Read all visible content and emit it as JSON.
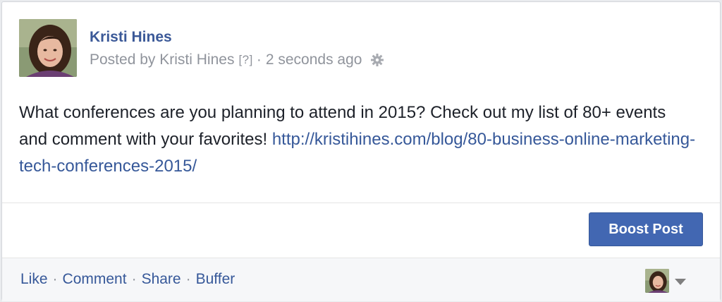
{
  "post": {
    "author_name": "Kristi Hines",
    "meta": {
      "prefix": "Posted by",
      "poster": "Kristi Hines",
      "help": "[?]",
      "separator": "·",
      "time": "2 seconds ago"
    },
    "text": "What conferences are you planning to attend in 2015? Check out my list of 80+ events and comment with your favorites! ",
    "link": "http://kristihines.com/blog/80-business-online-marketing-tech-conferences-2015/"
  },
  "boost_button": {
    "label": "Boost Post"
  },
  "footer": {
    "actions": [
      "Like",
      "Comment",
      "Share",
      "Buffer"
    ],
    "separator": "·"
  },
  "colors": {
    "link_blue": "#365899",
    "author_blue": "#3b5998",
    "boost_bg": "#4267b2",
    "meta_gray": "#90949c"
  },
  "icons": [
    "gear-icon",
    "caret-down-icon",
    "avatar"
  ]
}
